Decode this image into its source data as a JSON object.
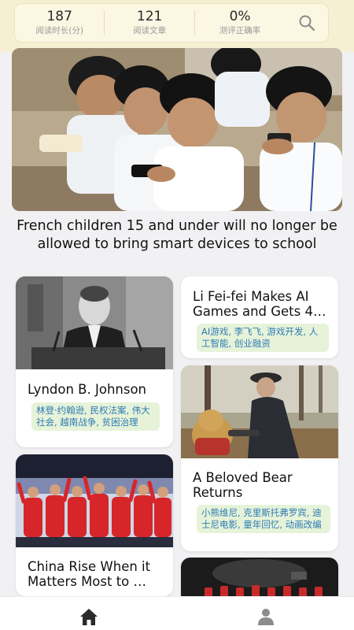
{
  "stats": [
    {
      "value": "187",
      "label": "阅读时长(分)"
    },
    {
      "value": "121",
      "label": "阅读文章"
    },
    {
      "value": "0%",
      "label": "测评正确率"
    }
  ],
  "hero": {
    "title": "French children 15 and under will no longer be allowed to bring smart devices to school"
  },
  "cards": {
    "johnson": {
      "title": "Lyndon B. Johnson",
      "tags": "林登·约翰逊, 民权法案, 伟大社会, 越南战争, 贫困治理"
    },
    "lifeifei": {
      "title": "Li Fei-fei Makes AI Games and Gets 4…",
      "tags": "AI游戏, 李飞飞, 游戏开发, 人工智能, 创业融资"
    },
    "bear": {
      "title": "A Beloved Bear Returns",
      "tags": "小熊维尼, 克里斯托弗罗宾, 迪士尼电影, 童年回忆, 动画改编"
    },
    "china": {
      "title": "China Rise When it Matters Most to …"
    }
  },
  "icons": {
    "search": "search-icon",
    "home": "home-icon",
    "profile": "person-icon"
  },
  "colors": {
    "accent": "#2f7bb5",
    "tag_bg": "#e6f3d9",
    "header_bg": "#f6f0d2",
    "nav_icon": "#2b2b2b"
  }
}
